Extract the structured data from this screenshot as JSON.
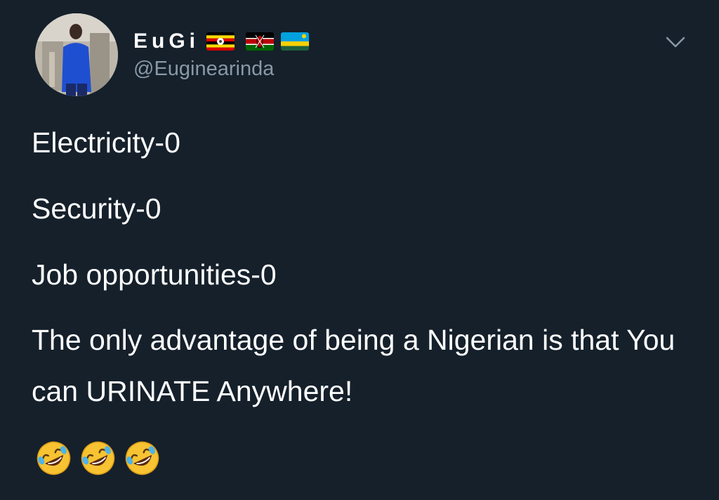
{
  "tweet": {
    "author": {
      "display_name": "EuGi",
      "handle": "@Euginearinda",
      "flags": [
        "uganda-flag",
        "kenya-flag",
        "rwanda-flag"
      ]
    },
    "lines": [
      "Electricity-0",
      "Security-0",
      "Job opportunities-0",
      "The only advantage of being a Nigerian is that You can URINATE Anywhere!"
    ],
    "emojis": [
      "rolling-on-floor-laughing-emoji",
      "rolling-on-floor-laughing-emoji",
      "rolling-on-floor-laughing-emoji"
    ],
    "menu_icon": "chevron-down-icon"
  },
  "colors": {
    "background": "#15202b",
    "text_primary": "#ffffff",
    "text_secondary": "#8899a6"
  }
}
